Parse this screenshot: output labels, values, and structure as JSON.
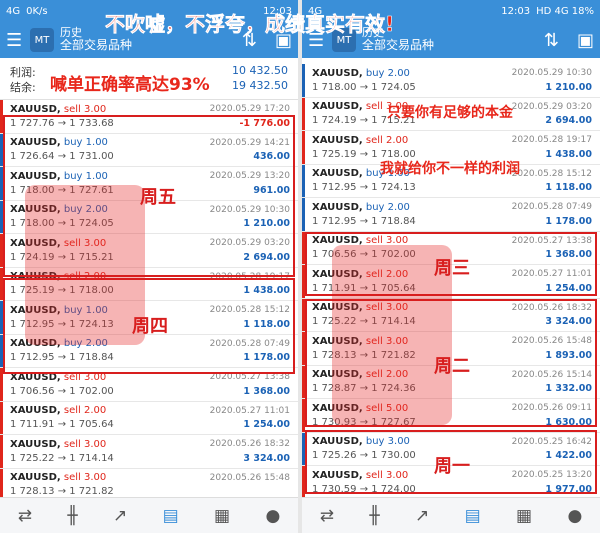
{
  "banner": "不吹嘘，不浮夸，成绩真实有效!",
  "left": {
    "status": {
      "network": "4G",
      "speed": "0K/s",
      "time": "12:03"
    },
    "app": {
      "title_small": "历史",
      "title_main": "全部交易品种"
    },
    "summary": {
      "profit_label": "利润:",
      "profit_value": "10 432.50",
      "balance_label": "结余:",
      "balance_value": "19 432.50",
      "claim": "喊单正确率高达93%"
    },
    "trades": [
      {
        "symbol": "XAUUSD,",
        "side": "sell 3.00",
        "type": "sell",
        "prices": "1 727.76 → 1 733.68",
        "time": "2020.05.29 17:20",
        "profit": "-1 776.00",
        "neg": true,
        "bar": "#e0261b"
      },
      {
        "symbol": "XAUUSD,",
        "side": "buy 1.00",
        "type": "buy",
        "prices": "1 726.64 → 1 731.00",
        "time": "2020.05.29 14:21",
        "profit": "436.00",
        "neg": false,
        "bar": "#1b62b5"
      },
      {
        "symbol": "XAUUSD,",
        "side": "buy 1.00",
        "type": "buy",
        "prices": "1 718.00 → 1 727.61",
        "time": "2020.05.29 13:20",
        "profit": "961.00",
        "neg": false,
        "bar": "#1b62b5"
      },
      {
        "symbol": "XAUUSD,",
        "side": "buy 2.00",
        "type": "buy",
        "prices": "1 718.00 → 1 724.05",
        "time": "2020.05.29 10:30",
        "profit": "1 210.00",
        "neg": false,
        "bar": "#1b62b5"
      },
      {
        "symbol": "XAUUSD,",
        "side": "sell 3.00",
        "type": "sell",
        "prices": "1 724.19 → 1 715.21",
        "time": "2020.05.29 03:20",
        "profit": "2 694.00",
        "neg": false,
        "bar": "#e0261b"
      },
      {
        "symbol": "XAUUSD,",
        "side": "sell 2.00",
        "type": "sell",
        "prices": "1 725.19 → 1 718.00",
        "time": "2020.05.28 19:17",
        "profit": "1 438.00",
        "neg": false,
        "bar": "#e0261b"
      },
      {
        "symbol": "XAUUSD,",
        "side": "buy 1.00",
        "type": "buy",
        "prices": "1 712.95 → 1 724.13",
        "time": "2020.05.28 15:12",
        "profit": "1 118.00",
        "neg": false,
        "bar": "#1b62b5"
      },
      {
        "symbol": "XAUUSD,",
        "side": "buy 2.00",
        "type": "buy",
        "prices": "1 712.95 → 1 718.84",
        "time": "2020.05.28 07:49",
        "profit": "1 178.00",
        "neg": false,
        "bar": "#1b62b5"
      },
      {
        "symbol": "XAUUSD,",
        "side": "sell 3.00",
        "type": "sell",
        "prices": "1 706.56 → 1 702.00",
        "time": "2020.05.27 13:38",
        "profit": "1 368.00",
        "neg": false,
        "bar": "#e0261b"
      },
      {
        "symbol": "XAUUSD,",
        "side": "sell 2.00",
        "type": "sell",
        "prices": "1 711.91 → 1 705.64",
        "time": "2020.05.27 11:01",
        "profit": "1 254.00",
        "neg": false,
        "bar": "#e0261b"
      },
      {
        "symbol": "XAUUSD,",
        "side": "sell 3.00",
        "type": "sell",
        "prices": "1 725.22 → 1 714.14",
        "time": "2020.05.26 18:32",
        "profit": "3 324.00",
        "neg": false,
        "bar": "#e0261b"
      },
      {
        "symbol": "XAUUSD,",
        "side": "sell 3.00",
        "type": "sell",
        "prices": "1 728.13 → 1 721.82",
        "time": "2020.05.26 15:48",
        "profit": "",
        "neg": false,
        "bar": "#e0261b"
      }
    ],
    "labels": {
      "fri": "周五",
      "thu": "周四"
    }
  },
  "right": {
    "status": {
      "network": "4G",
      "time": "12:03",
      "battery": "HD 4G 18%"
    },
    "app": {
      "title_small": "历史",
      "title_main": "全部交易品种"
    },
    "trades": [
      {
        "symbol": "XAUUSD,",
        "side": "buy 2.00",
        "type": "buy",
        "prices": "1 718.00 → 1 724.05",
        "time": "2020.05.29 10:30",
        "profit": "1 210.00",
        "neg": false,
        "bar": "#1b62b5"
      },
      {
        "symbol": "XAUUSD,",
        "side": "sell 3.00",
        "type": "sell",
        "prices": "1 724.19 → 1 715.21",
        "time": "2020.05.29 03:20",
        "profit": "2 694.00",
        "neg": false,
        "bar": "#e0261b"
      },
      {
        "symbol": "XAUUSD,",
        "side": "sell 2.00",
        "type": "sell",
        "prices": "1 725.19 → 1 718.00",
        "time": "2020.05.28 19:17",
        "profit": "1 438.00",
        "neg": false,
        "bar": "#e0261b"
      },
      {
        "symbol": "XAUUSD,",
        "side": "buy 1.00",
        "type": "buy",
        "prices": "1 712.95 → 1 724.13",
        "time": "2020.05.28 15:12",
        "profit": "1 118.00",
        "neg": false,
        "bar": "#1b62b5"
      },
      {
        "symbol": "XAUUSD,",
        "side": "buy 2.00",
        "type": "buy",
        "prices": "1 712.95 → 1 718.84",
        "time": "2020.05.28 07:49",
        "profit": "1 178.00",
        "neg": false,
        "bar": "#1b62b5"
      },
      {
        "symbol": "XAUUSD,",
        "side": "sell 3.00",
        "type": "sell",
        "prices": "1 706.56 → 1 702.00",
        "time": "2020.05.27 13:38",
        "profit": "1 368.00",
        "neg": false,
        "bar": "#e0261b"
      },
      {
        "symbol": "XAUUSD,",
        "side": "sell 2.00",
        "type": "sell",
        "prices": "1 711.91 → 1 705.64",
        "time": "2020.05.27 11:01",
        "profit": "1 254.00",
        "neg": false,
        "bar": "#e0261b"
      },
      {
        "symbol": "XAUUSD,",
        "side": "sell 3.00",
        "type": "sell",
        "prices": "1 725.22 → 1 714.14",
        "time": "2020.05.26 18:32",
        "profit": "3 324.00",
        "neg": false,
        "bar": "#e0261b"
      },
      {
        "symbol": "XAUUSD,",
        "side": "sell 3.00",
        "type": "sell",
        "prices": "1 728.13 → 1 721.82",
        "time": "2020.05.26 15:48",
        "profit": "1 893.00",
        "neg": false,
        "bar": "#e0261b"
      },
      {
        "symbol": "XAUUSD,",
        "side": "sell 2.00",
        "type": "sell",
        "prices": "1 728.87 → 1 724.36",
        "time": "2020.05.26 15:14",
        "profit": "1 332.00",
        "neg": false,
        "bar": "#e0261b"
      },
      {
        "symbol": "XAUUSD,",
        "side": "sell 5.00",
        "type": "sell",
        "prices": "1 730.93 → 1 727.67",
        "time": "2020.05.26 09:11",
        "profit": "1 630.00",
        "neg": false,
        "bar": "#e0261b"
      },
      {
        "symbol": "XAUUSD,",
        "side": "buy 3.00",
        "type": "buy",
        "prices": "1 725.26 → 1 730.00",
        "time": "2020.05.25 16:42",
        "profit": "1 422.00",
        "neg": false,
        "bar": "#1b62b5"
      },
      {
        "symbol": "XAUUSD,",
        "side": "sell 3.00",
        "type": "sell",
        "prices": "1 730.59 → 1 724.00",
        "time": "2020.05.25 13:20",
        "profit": "1 977.00",
        "neg": false,
        "bar": "#e0261b"
      }
    ],
    "labels": {
      "need": "只要你有足够的本金",
      "give": "我就给你不一样的利润",
      "wed": "周三",
      "tue": "周二",
      "mon": "周一"
    }
  }
}
